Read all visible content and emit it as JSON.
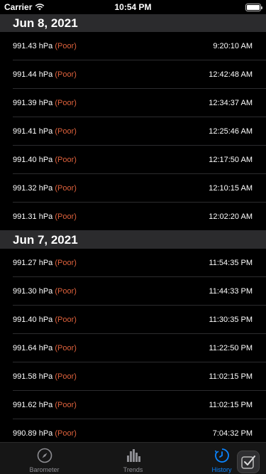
{
  "status_bar": {
    "carrier": "Carrier",
    "time": "10:54 PM"
  },
  "sections": [
    {
      "date": "Jun 8, 2021",
      "rows": [
        {
          "pressure": "991.43 hPa",
          "quality": "(Poor)",
          "time": "9:20:10 AM"
        },
        {
          "pressure": "991.44 hPa",
          "quality": "(Poor)",
          "time": "12:42:48 AM"
        },
        {
          "pressure": "991.39 hPa",
          "quality": "(Poor)",
          "time": "12:34:37 AM"
        },
        {
          "pressure": "991.41 hPa",
          "quality": "(Poor)",
          "time": "12:25:46 AM"
        },
        {
          "pressure": "991.40 hPa",
          "quality": "(Poor)",
          "time": "12:17:50 AM"
        },
        {
          "pressure": "991.32 hPa",
          "quality": "(Poor)",
          "time": "12:10:15 AM"
        },
        {
          "pressure": "991.31 hPa",
          "quality": "(Poor)",
          "time": "12:02:20 AM"
        }
      ]
    },
    {
      "date": "Jun 7, 2021",
      "rows": [
        {
          "pressure": "991.27 hPa",
          "quality": "(Poor)",
          "time": "11:54:35 PM"
        },
        {
          "pressure": "991.30 hPa",
          "quality": "(Poor)",
          "time": "11:44:33 PM"
        },
        {
          "pressure": "991.40 hPa",
          "quality": "(Poor)",
          "time": "11:30:35 PM"
        },
        {
          "pressure": "991.64 hPa",
          "quality": "(Poor)",
          "time": "11:22:50 PM"
        },
        {
          "pressure": "991.58 hPa",
          "quality": "(Poor)",
          "time": "11:02:15 PM"
        },
        {
          "pressure": "991.62 hPa",
          "quality": "(Poor)",
          "time": "11:02:15 PM"
        },
        {
          "pressure": "990.89 hPa",
          "quality": "(Poor)",
          "time": "7:04:32 PM"
        }
      ]
    }
  ],
  "tab_bar": {
    "tabs": [
      {
        "label": "Barometer",
        "icon": "compass-icon",
        "active": false
      },
      {
        "label": "Trends",
        "icon": "bar-chart-icon",
        "active": false
      },
      {
        "label": "History",
        "icon": "history-clock-icon",
        "active": true
      }
    ]
  },
  "colors": {
    "poor": "#e0623c",
    "accent": "#0a84ff",
    "section_bg": "#2b2b2d"
  }
}
